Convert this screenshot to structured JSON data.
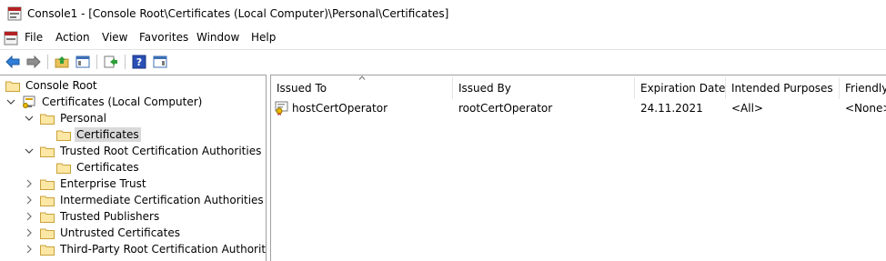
{
  "window": {
    "title": "Console1 - [Console Root\\Certificates (Local Computer)\\Personal\\Certificates]"
  },
  "menu": {
    "items": [
      "File",
      "Action",
      "View",
      "Favorites",
      "Window",
      "Help"
    ]
  },
  "toolbar": {
    "buttons": [
      "back-icon",
      "forward-icon",
      "up-folder-icon",
      "show-hide-tree-icon",
      "export-list-icon",
      "help-icon",
      "show-hide-action-pane-icon"
    ]
  },
  "tree": {
    "items": [
      {
        "label": "Console Root",
        "expanded": true
      },
      {
        "label": "Certificates (Local Computer)",
        "expanded": true
      },
      {
        "label": "Personal",
        "expanded": true
      },
      {
        "label": "Certificates",
        "selected": true
      },
      {
        "label": "Trusted Root Certification Authorities",
        "expanded": true
      },
      {
        "label": "Certificates"
      },
      {
        "label": "Enterprise Trust",
        "expanded": false
      },
      {
        "label": "Intermediate Certification Authorities",
        "expanded": false
      },
      {
        "label": "Trusted Publishers",
        "expanded": false
      },
      {
        "label": "Untrusted Certificates",
        "expanded": false
      },
      {
        "label": "Third-Party Root Certification Authorities",
        "expanded": false
      }
    ]
  },
  "list": {
    "columns": [
      "Issued To",
      "Issued By",
      "Expiration Date",
      "Intended Purposes",
      "Friendly"
    ],
    "sort_column": "Issued To",
    "rows": [
      {
        "issued_to": "hostCertOperator",
        "issued_by": "rootCertOperator",
        "expiration": "24.11.2021",
        "purposes": "<All>",
        "friendly": "<None>"
      }
    ]
  },
  "colors": {
    "selection": "#d9d9d9",
    "pane_border": "#a0a0a0",
    "folder": "#e8c35a"
  }
}
